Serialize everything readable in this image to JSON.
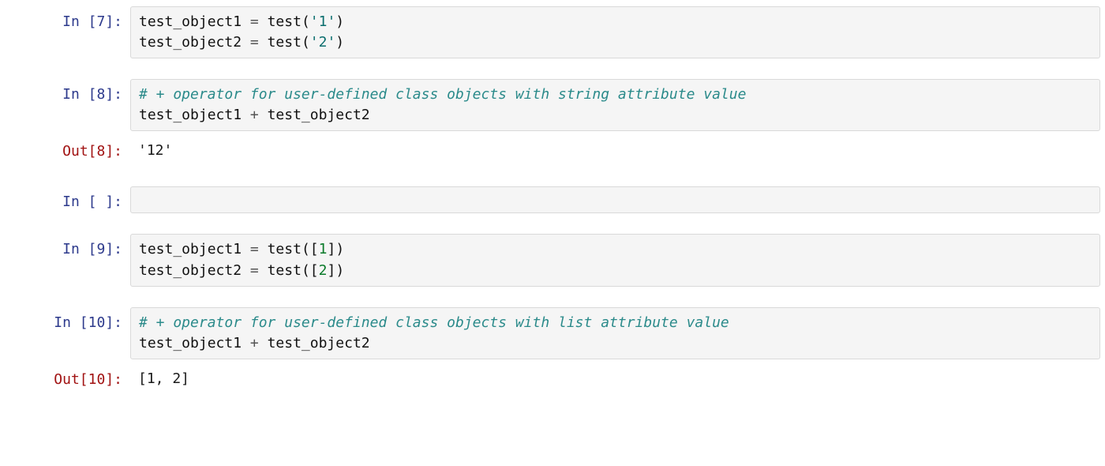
{
  "cells": [
    {
      "id": "c7",
      "prompt_in": "In [7]:",
      "code_tokens": [
        {
          "t": "test_object1 ",
          "c": "tok-name"
        },
        {
          "t": "=",
          "c": "tok-op"
        },
        {
          "t": " ",
          "c": "tok-name"
        },
        {
          "t": "test",
          "c": "tok-func"
        },
        {
          "t": "(",
          "c": "tok-punc"
        },
        {
          "t": "'1'",
          "c": "tok-str"
        },
        {
          "t": ")",
          "c": "tok-punc"
        },
        {
          "t": "\n",
          "c": ""
        },
        {
          "t": "test_object2 ",
          "c": "tok-name"
        },
        {
          "t": "=",
          "c": "tok-op"
        },
        {
          "t": " ",
          "c": "tok-name"
        },
        {
          "t": "test",
          "c": "tok-func"
        },
        {
          "t": "(",
          "c": "tok-punc"
        },
        {
          "t": "'2'",
          "c": "tok-str"
        },
        {
          "t": ")",
          "c": "tok-punc"
        }
      ]
    },
    {
      "id": "c8",
      "prompt_in": "In [8]:",
      "code_tokens": [
        {
          "t": "# + operator for user-defined class objects with string attribute value",
          "c": "tok-comment"
        },
        {
          "t": "\n",
          "c": ""
        },
        {
          "t": "test_object1 ",
          "c": "tok-name"
        },
        {
          "t": "+",
          "c": "tok-op"
        },
        {
          "t": " test_object2",
          "c": "tok-name"
        }
      ],
      "prompt_out": "Out[8]:",
      "output": "'12'"
    },
    {
      "id": "cempty",
      "prompt_in": "In [ ]:",
      "empty": true
    },
    {
      "id": "c9",
      "prompt_in": "In [9]:",
      "code_tokens": [
        {
          "t": "test_object1 ",
          "c": "tok-name"
        },
        {
          "t": "=",
          "c": "tok-op"
        },
        {
          "t": " ",
          "c": "tok-name"
        },
        {
          "t": "test",
          "c": "tok-func"
        },
        {
          "t": "(",
          "c": "tok-punc"
        },
        {
          "t": "[",
          "c": "tok-punc"
        },
        {
          "t": "1",
          "c": "tok-num"
        },
        {
          "t": "]",
          "c": "tok-punc"
        },
        {
          "t": ")",
          "c": "tok-punc"
        },
        {
          "t": "\n",
          "c": ""
        },
        {
          "t": "test_object2 ",
          "c": "tok-name"
        },
        {
          "t": "=",
          "c": "tok-op"
        },
        {
          "t": " ",
          "c": "tok-name"
        },
        {
          "t": "test",
          "c": "tok-func"
        },
        {
          "t": "(",
          "c": "tok-punc"
        },
        {
          "t": "[",
          "c": "tok-punc"
        },
        {
          "t": "2",
          "c": "tok-num"
        },
        {
          "t": "]",
          "c": "tok-punc"
        },
        {
          "t": ")",
          "c": "tok-punc"
        }
      ]
    },
    {
      "id": "c10",
      "prompt_in": "In [10]:",
      "code_tokens": [
        {
          "t": "# + operator for user-defined class objects with list attribute value",
          "c": "tok-comment"
        },
        {
          "t": "\n",
          "c": ""
        },
        {
          "t": "test_object1 ",
          "c": "tok-name"
        },
        {
          "t": "+",
          "c": "tok-op"
        },
        {
          "t": " test_object2",
          "c": "tok-name"
        }
      ],
      "prompt_out": "Out[10]:",
      "output": "[1, 2]"
    }
  ]
}
